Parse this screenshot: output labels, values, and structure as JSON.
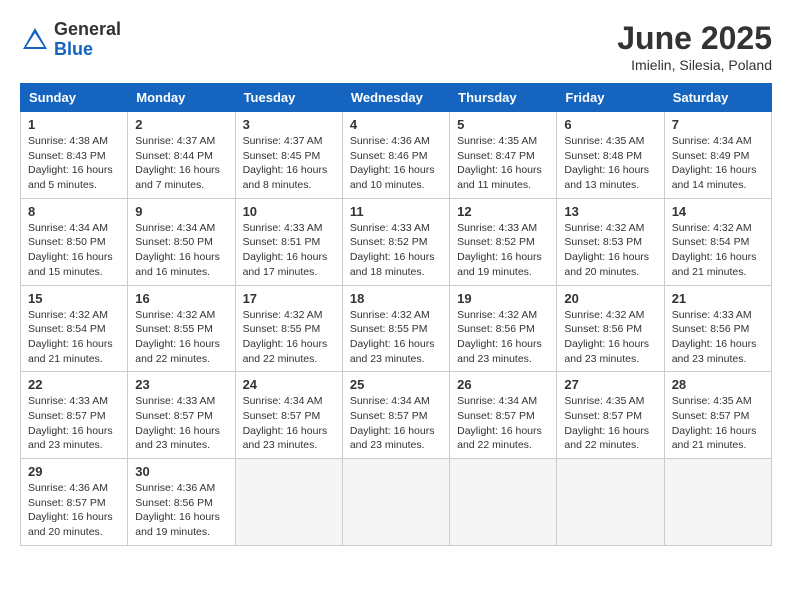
{
  "logo": {
    "general": "General",
    "blue": "Blue"
  },
  "title": "June 2025",
  "location": "Imielin, Silesia, Poland",
  "days_header": [
    "Sunday",
    "Monday",
    "Tuesday",
    "Wednesday",
    "Thursday",
    "Friday",
    "Saturday"
  ],
  "weeks": [
    [
      {
        "day": "1",
        "sunrise": "4:38 AM",
        "sunset": "8:43 PM",
        "daylight": "16 hours and 5 minutes."
      },
      {
        "day": "2",
        "sunrise": "4:37 AM",
        "sunset": "8:44 PM",
        "daylight": "16 hours and 7 minutes."
      },
      {
        "day": "3",
        "sunrise": "4:37 AM",
        "sunset": "8:45 PM",
        "daylight": "16 hours and 8 minutes."
      },
      {
        "day": "4",
        "sunrise": "4:36 AM",
        "sunset": "8:46 PM",
        "daylight": "16 hours and 10 minutes."
      },
      {
        "day": "5",
        "sunrise": "4:35 AM",
        "sunset": "8:47 PM",
        "daylight": "16 hours and 11 minutes."
      },
      {
        "day": "6",
        "sunrise": "4:35 AM",
        "sunset": "8:48 PM",
        "daylight": "16 hours and 13 minutes."
      },
      {
        "day": "7",
        "sunrise": "4:34 AM",
        "sunset": "8:49 PM",
        "daylight": "16 hours and 14 minutes."
      }
    ],
    [
      {
        "day": "8",
        "sunrise": "4:34 AM",
        "sunset": "8:50 PM",
        "daylight": "16 hours and 15 minutes."
      },
      {
        "day": "9",
        "sunrise": "4:34 AM",
        "sunset": "8:50 PM",
        "daylight": "16 hours and 16 minutes."
      },
      {
        "day": "10",
        "sunrise": "4:33 AM",
        "sunset": "8:51 PM",
        "daylight": "16 hours and 17 minutes."
      },
      {
        "day": "11",
        "sunrise": "4:33 AM",
        "sunset": "8:52 PM",
        "daylight": "16 hours and 18 minutes."
      },
      {
        "day": "12",
        "sunrise": "4:33 AM",
        "sunset": "8:52 PM",
        "daylight": "16 hours and 19 minutes."
      },
      {
        "day": "13",
        "sunrise": "4:32 AM",
        "sunset": "8:53 PM",
        "daylight": "16 hours and 20 minutes."
      },
      {
        "day": "14",
        "sunrise": "4:32 AM",
        "sunset": "8:54 PM",
        "daylight": "16 hours and 21 minutes."
      }
    ],
    [
      {
        "day": "15",
        "sunrise": "4:32 AM",
        "sunset": "8:54 PM",
        "daylight": "16 hours and 21 minutes."
      },
      {
        "day": "16",
        "sunrise": "4:32 AM",
        "sunset": "8:55 PM",
        "daylight": "16 hours and 22 minutes."
      },
      {
        "day": "17",
        "sunrise": "4:32 AM",
        "sunset": "8:55 PM",
        "daylight": "16 hours and 22 minutes."
      },
      {
        "day": "18",
        "sunrise": "4:32 AM",
        "sunset": "8:55 PM",
        "daylight": "16 hours and 23 minutes."
      },
      {
        "day": "19",
        "sunrise": "4:32 AM",
        "sunset": "8:56 PM",
        "daylight": "16 hours and 23 minutes."
      },
      {
        "day": "20",
        "sunrise": "4:32 AM",
        "sunset": "8:56 PM",
        "daylight": "16 hours and 23 minutes."
      },
      {
        "day": "21",
        "sunrise": "4:33 AM",
        "sunset": "8:56 PM",
        "daylight": "16 hours and 23 minutes."
      }
    ],
    [
      {
        "day": "22",
        "sunrise": "4:33 AM",
        "sunset": "8:57 PM",
        "daylight": "16 hours and 23 minutes."
      },
      {
        "day": "23",
        "sunrise": "4:33 AM",
        "sunset": "8:57 PM",
        "daylight": "16 hours and 23 minutes."
      },
      {
        "day": "24",
        "sunrise": "4:34 AM",
        "sunset": "8:57 PM",
        "daylight": "16 hours and 23 minutes."
      },
      {
        "day": "25",
        "sunrise": "4:34 AM",
        "sunset": "8:57 PM",
        "daylight": "16 hours and 23 minutes."
      },
      {
        "day": "26",
        "sunrise": "4:34 AM",
        "sunset": "8:57 PM",
        "daylight": "16 hours and 22 minutes."
      },
      {
        "day": "27",
        "sunrise": "4:35 AM",
        "sunset": "8:57 PM",
        "daylight": "16 hours and 22 minutes."
      },
      {
        "day": "28",
        "sunrise": "4:35 AM",
        "sunset": "8:57 PM",
        "daylight": "16 hours and 21 minutes."
      }
    ],
    [
      {
        "day": "29",
        "sunrise": "4:36 AM",
        "sunset": "8:57 PM",
        "daylight": "16 hours and 20 minutes."
      },
      {
        "day": "30",
        "sunrise": "4:36 AM",
        "sunset": "8:56 PM",
        "daylight": "16 hours and 19 minutes."
      },
      null,
      null,
      null,
      null,
      null
    ]
  ],
  "labels": {
    "sunrise": "Sunrise:",
    "sunset": "Sunset:",
    "daylight": "Daylight:"
  }
}
